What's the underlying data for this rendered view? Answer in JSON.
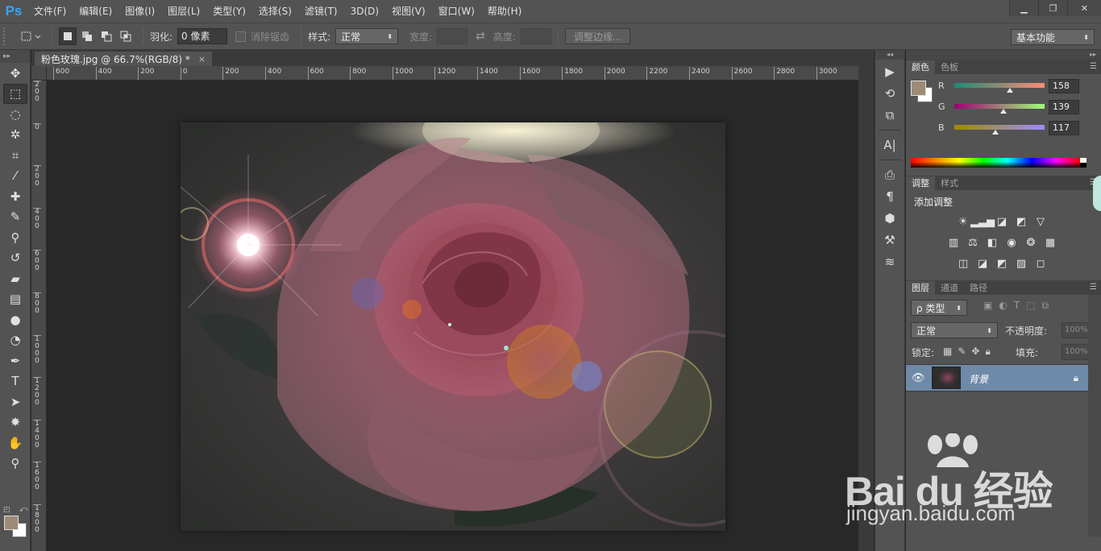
{
  "app": {
    "logo": "Ps",
    "menu": [
      "文件(F)",
      "编辑(E)",
      "图像(I)",
      "图层(L)",
      "类型(Y)",
      "选择(S)",
      "滤镜(T)",
      "3D(D)",
      "视图(V)",
      "窗口(W)",
      "帮助(H)"
    ],
    "window_controls": {
      "minimize": "▁",
      "restore": "❐",
      "close": "✕"
    }
  },
  "options": {
    "tool_icon": "rect-marquee-icon",
    "feather_label": "羽化:",
    "feather_value": "0 像素",
    "antialias_label": "消除锯齿",
    "style_label": "样式:",
    "style_value": "正常",
    "width_label": "宽度:",
    "height_label": "高度:",
    "refine_edge": "调整边缘...",
    "workspace": "基本功能"
  },
  "document": {
    "tab_title": "粉色玫瑰.jpg @ 66.7%(RGB/8) *",
    "close": "×"
  },
  "rulers": {
    "horizontal": [
      "600",
      "400",
      "200",
      "0",
      "200",
      "400",
      "600",
      "800",
      "1000",
      "1200",
      "1400",
      "1600",
      "1800",
      "2000",
      "2200",
      "2400",
      "2600",
      "2800",
      "3000"
    ],
    "vertical": [
      "2\n0\n0",
      "0",
      "2\n0\n0",
      "4\n0\n0",
      "6\n0\n0",
      "8\n0\n0",
      "1\n0\n0\n0",
      "1\n2\n0\n0",
      "1\n4\n0\n0",
      "1\n6\n0\n0",
      "1\n8\n0\n0"
    ]
  },
  "tools": [
    {
      "name": "move-tool",
      "glyph": "✥"
    },
    {
      "name": "rect-marquee-tool",
      "glyph": "⬚",
      "active": true
    },
    {
      "name": "lasso-tool",
      "glyph": "◌"
    },
    {
      "name": "magic-wand-tool",
      "glyph": "✲"
    },
    {
      "name": "crop-tool",
      "glyph": "⌗"
    },
    {
      "name": "eyedropper-tool",
      "glyph": "⁄"
    },
    {
      "name": "healing-brush-tool",
      "glyph": "✚"
    },
    {
      "name": "brush-tool",
      "glyph": "✎"
    },
    {
      "name": "clone-stamp-tool",
      "glyph": "⚲"
    },
    {
      "name": "history-brush-tool",
      "glyph": "↺"
    },
    {
      "name": "eraser-tool",
      "glyph": "▰"
    },
    {
      "name": "gradient-tool",
      "glyph": "▤"
    },
    {
      "name": "blur-tool",
      "glyph": "●"
    },
    {
      "name": "dodge-tool",
      "glyph": "◔"
    },
    {
      "name": "pen-tool",
      "glyph": "✒"
    },
    {
      "name": "type-tool",
      "glyph": "T"
    },
    {
      "name": "path-selection-tool",
      "glyph": "➤"
    },
    {
      "name": "shape-tool",
      "glyph": "✸"
    },
    {
      "name": "hand-tool",
      "glyph": "✋"
    },
    {
      "name": "zoom-tool",
      "glyph": "⚲"
    }
  ],
  "colors": {
    "foreground": "#9e8b75",
    "background": "#ffffff"
  },
  "color_panel": {
    "tabs": [
      "颜色",
      "色板"
    ],
    "r_label": "R",
    "r_value": "158",
    "r": 158,
    "g_label": "G",
    "g_value": "139",
    "g": 139,
    "b_label": "B",
    "b_value": "117",
    "b": 117
  },
  "adjustments_panel": {
    "tabs": [
      "调整",
      "样式"
    ],
    "title": "添加调整",
    "rows": [
      [
        "brightness-icon",
        "levels-icon",
        "curves-icon",
        "exposure-icon",
        "vibrance-icon"
      ],
      [
        "hue-saturation-icon",
        "color-balance-icon",
        "black-white-icon",
        "photo-filter-icon",
        "channel-mixer-icon",
        "color-lookup-icon"
      ],
      [
        "invert-icon",
        "posterize-icon",
        "threshold-icon",
        "gradient-map-icon",
        "selective-color-icon"
      ]
    ]
  },
  "layers_panel": {
    "tabs": [
      "图层",
      "通道",
      "路径"
    ],
    "filter": "ρ 类型",
    "blend_mode": "正常",
    "opacity_label": "不透明度:",
    "opacity_value": "100%",
    "lock_label": "锁定:",
    "fill_label": "填充:",
    "fill_value": "100%",
    "layers": [
      {
        "name": "背景",
        "visible": true,
        "locked": true
      }
    ]
  },
  "watermark": {
    "main": "Bai du 经验",
    "sub": "jingyan.baidu.com"
  }
}
